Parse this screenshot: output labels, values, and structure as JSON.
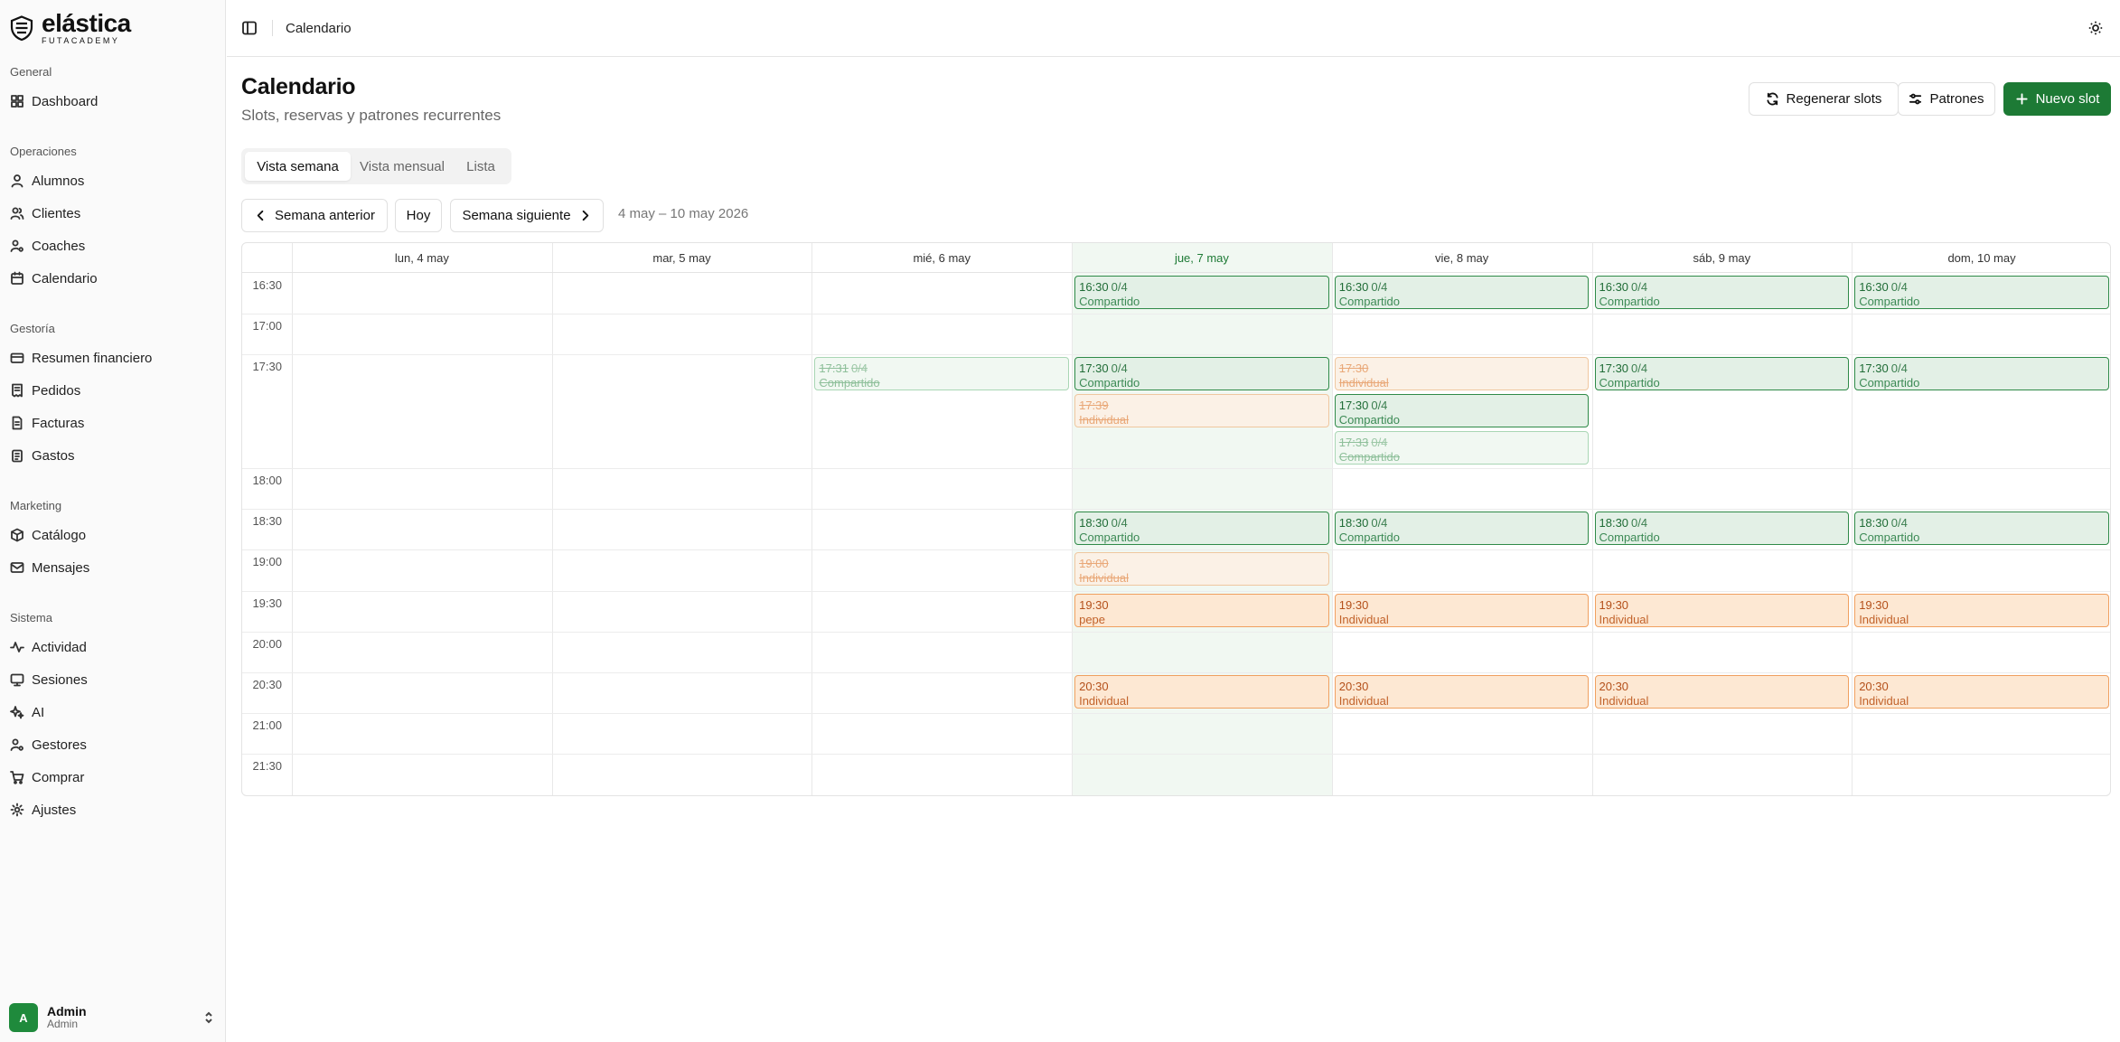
{
  "brand": {
    "name": "elástica",
    "sub": "FUTACADEMY"
  },
  "sidebar": {
    "groups": [
      {
        "label": "General"
      },
      {
        "label": "Operaciones"
      },
      {
        "label": "Gestoría"
      },
      {
        "label": "Marketing"
      },
      {
        "label": "Sistema"
      }
    ],
    "items": {
      "dashboard": "Dashboard",
      "alumnos": "Alumnos",
      "clientes": "Clientes",
      "coaches": "Coaches",
      "calendario": "Calendario",
      "resumen": "Resumen financiero",
      "pedidos": "Pedidos",
      "facturas": "Facturas",
      "gastos": "Gastos",
      "catalogo": "Catálogo",
      "mensajes": "Mensajes",
      "actividad": "Actividad",
      "sesiones": "Sesiones",
      "ai": "AI",
      "gestores": "Gestores",
      "comprar": "Comprar",
      "ajustes": "Ajustes"
    },
    "user": {
      "initial": "A",
      "name": "Admin",
      "role": "Admin"
    }
  },
  "topbar": {
    "title": "Calendario"
  },
  "header": {
    "title": "Calendario",
    "subtitle": "Slots, reservas y patrones recurrentes",
    "regen_label": "Regenerar slots",
    "patterns_label": "Patrones",
    "new_label": "Nuevo slot"
  },
  "tabs": {
    "week": "Vista semana",
    "month": "Vista mensual",
    "list": "Lista",
    "active": "week"
  },
  "week_nav": {
    "prev": "Semana anterior",
    "today": "Hoy",
    "next": "Semana siguiente",
    "range": "4 may – 10 may 2026"
  },
  "calendar": {
    "days": [
      "lun, 4 may",
      "mar, 5 may",
      "mié, 6 may",
      "jue, 7 may",
      "vie, 8 may",
      "sáb, 9 may",
      "dom, 10 may"
    ],
    "today_index": 3,
    "rows": [
      "16:30",
      "17:00",
      "17:30",
      "18:00",
      "18:30",
      "19:00",
      "19:30",
      "20:00",
      "20:30",
      "21:00",
      "21:30"
    ],
    "slots": [
      {
        "day": 3,
        "row": 0,
        "stack": 0,
        "time": "16:30",
        "cap": "0/4",
        "label": "Compartido",
        "kind": "shared"
      },
      {
        "day": 4,
        "row": 0,
        "stack": 0,
        "time": "16:30",
        "cap": "0/4",
        "label": "Compartido",
        "kind": "shared"
      },
      {
        "day": 5,
        "row": 0,
        "stack": 0,
        "time": "16:30",
        "cap": "0/4",
        "label": "Compartido",
        "kind": "shared"
      },
      {
        "day": 6,
        "row": 0,
        "stack": 0,
        "time": "16:30",
        "cap": "0/4",
        "label": "Compartido",
        "kind": "shared"
      },
      {
        "day": 2,
        "row": 2,
        "stack": 0,
        "time": "17:31",
        "cap": "0/4",
        "label": "Compartido",
        "kind": "cancel-g"
      },
      {
        "day": 3,
        "row": 2,
        "stack": 0,
        "time": "17:30",
        "cap": "0/4",
        "label": "Compartido",
        "kind": "shared"
      },
      {
        "day": 3,
        "row": 2,
        "stack": 1,
        "time": "17:39",
        "cap": "",
        "label": "Individual",
        "kind": "cancel-o"
      },
      {
        "day": 4,
        "row": 2,
        "stack": 0,
        "time": "17:30",
        "cap": "",
        "label": "Individual",
        "kind": "cancel-o"
      },
      {
        "day": 4,
        "row": 2,
        "stack": 1,
        "time": "17:30",
        "cap": "0/4",
        "label": "Compartido",
        "kind": "shared"
      },
      {
        "day": 4,
        "row": 2,
        "stack": 2,
        "time": "17:33",
        "cap": "0/4",
        "label": "Compartido",
        "kind": "cancel-g"
      },
      {
        "day": 5,
        "row": 2,
        "stack": 0,
        "time": "17:30",
        "cap": "0/4",
        "label": "Compartido",
        "kind": "shared"
      },
      {
        "day": 6,
        "row": 2,
        "stack": 0,
        "time": "17:30",
        "cap": "0/4",
        "label": "Compartido",
        "kind": "shared"
      },
      {
        "day": 3,
        "row": 4,
        "stack": 0,
        "time": "18:30",
        "cap": "0/4",
        "label": "Compartido",
        "kind": "shared"
      },
      {
        "day": 4,
        "row": 4,
        "stack": 0,
        "time": "18:30",
        "cap": "0/4",
        "label": "Compartido",
        "kind": "shared"
      },
      {
        "day": 5,
        "row": 4,
        "stack": 0,
        "time": "18:30",
        "cap": "0/4",
        "label": "Compartido",
        "kind": "shared"
      },
      {
        "day": 6,
        "row": 4,
        "stack": 0,
        "time": "18:30",
        "cap": "0/4",
        "label": "Compartido",
        "kind": "shared"
      },
      {
        "day": 3,
        "row": 5,
        "stack": 0,
        "time": "19:00",
        "cap": "",
        "label": "Individual",
        "kind": "cancel-o"
      },
      {
        "day": 3,
        "row": 6,
        "stack": 0,
        "time": "19:30",
        "cap": "",
        "label": "pepe",
        "kind": "indiv"
      },
      {
        "day": 4,
        "row": 6,
        "stack": 0,
        "time": "19:30",
        "cap": "",
        "label": "Individual",
        "kind": "indiv"
      },
      {
        "day": 5,
        "row": 6,
        "stack": 0,
        "time": "19:30",
        "cap": "",
        "label": "Individual",
        "kind": "indiv"
      },
      {
        "day": 6,
        "row": 6,
        "stack": 0,
        "time": "19:30",
        "cap": "",
        "label": "Individual",
        "kind": "indiv"
      },
      {
        "day": 3,
        "row": 8,
        "stack": 0,
        "time": "20:30",
        "cap": "",
        "label": "Individual",
        "kind": "indiv"
      },
      {
        "day": 4,
        "row": 8,
        "stack": 0,
        "time": "20:30",
        "cap": "",
        "label": "Individual",
        "kind": "indiv"
      },
      {
        "day": 5,
        "row": 8,
        "stack": 0,
        "time": "20:30",
        "cap": "",
        "label": "Individual",
        "kind": "indiv"
      },
      {
        "day": 6,
        "row": 8,
        "stack": 0,
        "time": "20:30",
        "cap": "",
        "label": "Individual",
        "kind": "indiv"
      }
    ]
  }
}
